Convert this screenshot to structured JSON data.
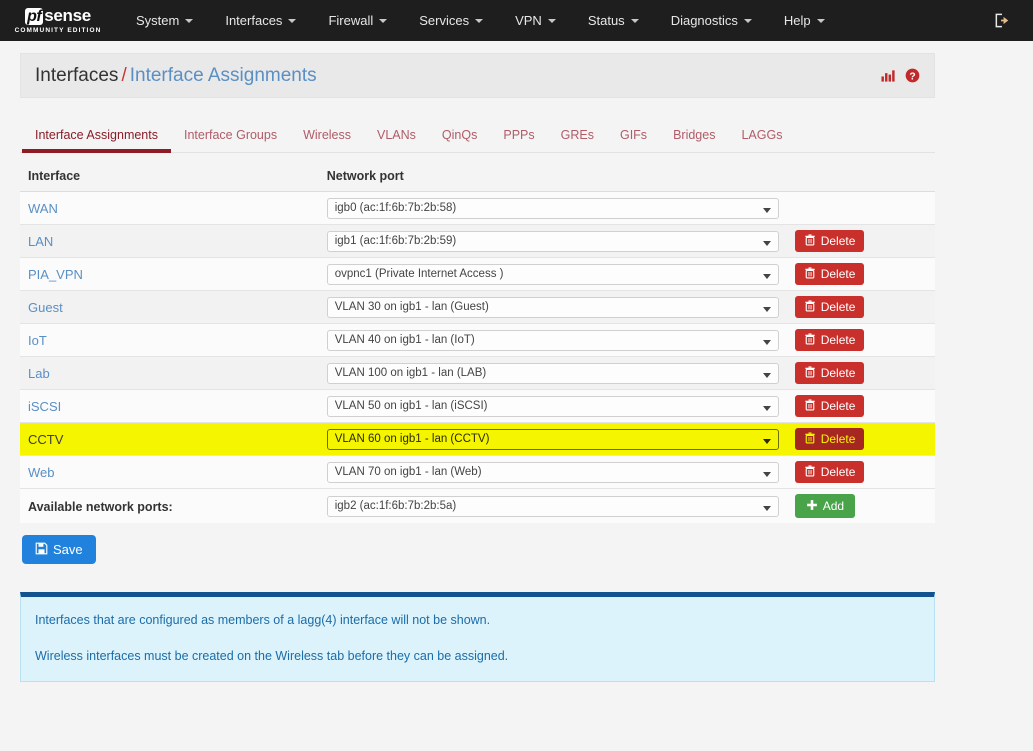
{
  "navbar": {
    "brand": {
      "pf": "pf",
      "sense": "sense",
      "subtitle": "COMMUNITY EDITION"
    },
    "items": [
      {
        "label": "System",
        "has_caret": true
      },
      {
        "label": "Interfaces",
        "has_caret": true
      },
      {
        "label": "Firewall",
        "has_caret": true
      },
      {
        "label": "Services",
        "has_caret": true
      },
      {
        "label": "VPN",
        "has_caret": true
      },
      {
        "label": "Status",
        "has_caret": true
      },
      {
        "label": "Diagnostics",
        "has_caret": true
      },
      {
        "label": "Help",
        "has_caret": true
      }
    ],
    "logout_icon": "logout-icon"
  },
  "header": {
    "breadcrumb_first": "Interfaces",
    "breadcrumb_separator": "/",
    "breadcrumb_last": "Interface Assignments",
    "icons": [
      "status-chart-icon",
      "help-icon"
    ]
  },
  "tabs": [
    {
      "label": "Interface Assignments",
      "active": true
    },
    {
      "label": "Interface Groups",
      "active": false
    },
    {
      "label": "Wireless",
      "active": false
    },
    {
      "label": "VLANs",
      "active": false
    },
    {
      "label": "QinQs",
      "active": false
    },
    {
      "label": "PPPs",
      "active": false
    },
    {
      "label": "GREs",
      "active": false
    },
    {
      "label": "GIFs",
      "active": false
    },
    {
      "label": "Bridges",
      "active": false
    },
    {
      "label": "LAGGs",
      "active": false
    }
  ],
  "table": {
    "columns": [
      "Interface",
      "Network port"
    ],
    "rows": [
      {
        "interface": "WAN",
        "port": "igb0 (ac:1f:6b:7b:2b:58)",
        "delete": false,
        "highlighted": false
      },
      {
        "interface": "LAN",
        "port": "igb1 (ac:1f:6b:7b:2b:59)",
        "delete": true,
        "highlighted": false
      },
      {
        "interface": "PIA_VPN",
        "port": "ovpnc1 (Private Internet Access )",
        "delete": true,
        "highlighted": false
      },
      {
        "interface": "Guest",
        "port": "VLAN 30 on igb1 - lan (Guest)",
        "delete": true,
        "highlighted": false
      },
      {
        "interface": "IoT",
        "port": "VLAN 40 on igb1 - lan (IoT)",
        "delete": true,
        "highlighted": false
      },
      {
        "interface": "Lab",
        "port": "VLAN 100 on igb1 - lan (LAB)",
        "delete": true,
        "highlighted": false
      },
      {
        "interface": "iSCSI",
        "port": "VLAN 50 on igb1 - lan (iSCSI)",
        "delete": true,
        "highlighted": false
      },
      {
        "interface": "CCTV",
        "port": "VLAN 60 on igb1 - lan (CCTV)",
        "delete": true,
        "highlighted": true
      },
      {
        "interface": "Web",
        "port": "VLAN 70 on igb1 - lan (Web)",
        "delete": true,
        "highlighted": false
      }
    ],
    "available_label": "Available network ports:",
    "available_port": "igb2 (ac:1f:6b:7b:2b:5a)",
    "delete_label": "Delete",
    "add_label": "Add"
  },
  "save_label": "Save",
  "info": {
    "line1": "Interfaces that are configured as members of a lagg(4) interface will not be shown.",
    "line2": "Wireless interfaces must be created on the Wireless tab before they can be assigned."
  },
  "colors": {
    "navbar_bg": "#1e1e1e",
    "accent_red": "#8f1b26",
    "delete_red": "#c9302c",
    "add_green": "#49a349",
    "save_blue": "#2082dd",
    "highlight_yellow": "#f5f500",
    "link_blue": "#5a8fc4",
    "info_bg": "#ddf3fb",
    "info_border_top": "#11528f"
  }
}
